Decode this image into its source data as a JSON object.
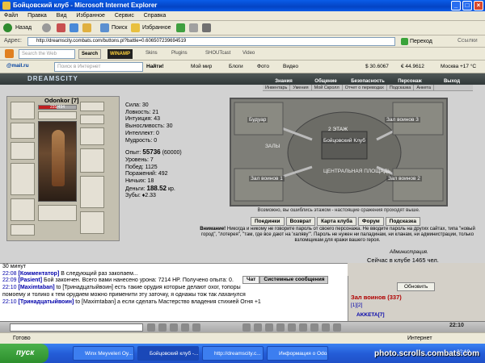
{
  "window": {
    "title": "Бойцовский клуб - Microsoft Internet Explorer"
  },
  "menu": [
    "Файл",
    "Правка",
    "Вид",
    "Избранное",
    "Сервис",
    "Справка"
  ],
  "toolbar": {
    "back": "Назад",
    "search": "Поиск",
    "favorites": "Избранное"
  },
  "address": {
    "label": "Адрес:",
    "url": "http://dreamscity.combats.com/buttons.pl?battle=0.606507239694519",
    "go": "Переход",
    "links": "Ссылки"
  },
  "winamp": {
    "search_placeholder": "Search the Web",
    "search_btn": "Search",
    "logo": "WINAMP",
    "items": [
      "Skins",
      "Plugins",
      "SHOUTcast",
      "Video"
    ]
  },
  "mailbar": {
    "logo": "@mail.ru",
    "search_placeholder": "Поиск в Интернет",
    "find": "Найти!",
    "items": [
      "Мой мир",
      "Блоги",
      "Фото",
      "Видео"
    ],
    "rate_usd": "$ 30.6067",
    "rate_eur": "€ 44.9612",
    "weather": "Москва +17 °C"
  },
  "game": {
    "banner": "DREAMSCITY",
    "nav": [
      "Знания",
      "Общение",
      "Безопасность",
      "Персонаж",
      "Выход"
    ],
    "subnav": [
      "Инвентарь",
      "Умения",
      "Мой Скролл",
      "Отчет о переводах",
      "Подсказка",
      "Анкета"
    ],
    "char_name": "Odonkor [7]",
    "hp": "231/494",
    "hp_fraction": 0.47,
    "stats": {
      "s1": "Сила: 30",
      "s2": "Ловкость: 21",
      "s3": "Интуиция: 43",
      "s4": "Выносливость: 30",
      "s5": "Интеллект: 0",
      "s6": "Мудрость: 0",
      "exp_label": "Опыт:",
      "exp": "55736",
      "exp_next": "(60000)",
      "s7": "Уровень: 7",
      "s8": "Побед: 1125",
      "s9": "Поражений: 492",
      "s10": "Ничьих: 18",
      "money_label": "Деньги:",
      "money": "188.52",
      "money_unit": "кр.",
      "teeth": "Зубы: ♦2.33"
    },
    "rooms": {
      "r1": "Будуар",
      "r2": "Зал воинов 3",
      "r3": "2 ЭТАЖ",
      "r4": "Бойцовский Клуб",
      "r5": "ЗАЛЫ",
      "r6": "ЦЕНТРАЛЬНАЯ ПЛОЩАДЬ",
      "r7": "Зал воинов 1",
      "r8": "Зал воинов 2"
    },
    "floor_hint": "Возможно, вы ошиблись этажом - настоящие сражения проходят выше.",
    "buttons": [
      "Поединки",
      "Возврат",
      "Карта клуба",
      "Форум",
      "Подсказка"
    ],
    "warning_title": "Внимание!",
    "warning_text": "Никогда и никому не говорите пароль от своего персонажа. Не вводите пароль на других сайтах, типа \"новый город\", \"лотерея\", \"там, где все дают на 'халяву'\". Пароль не нужен ни паладинам, ни кланам, ни администрации, только взломщикам для кражи вашего героя.",
    "warning_sign": "Администрация.",
    "online": "Сейчас в клубе 1465 чел."
  },
  "chat": {
    "first": "30 минут",
    "lines": [
      {
        "t": "22:08",
        "n": "[Комментатор]",
        "m": "В следующий раз закопаем..."
      },
      {
        "t": "22:09",
        "n": "[Pasient]",
        "m": "Бой закончен. Всего вами нанесено урона: 7214 HP. Получено опыта: 0."
      },
      {
        "t": "22:10",
        "n": "[Maximtaban]",
        "m": "to [Тринадцатыйвоин] есть такие орудия которые делают охог, топоры"
      },
      {
        "t": "",
        "n": "",
        "m": "помоему и толико к тем орудием можно применити эту заточку, я однажы тож так лаханулся"
      },
      {
        "t": "22:10",
        "n": "[Тринадцатыйвоин]",
        "m": "to [Maximtaban] а если сделать Мастерство владения стихией Огня +1"
      }
    ],
    "tab_chat": "Чат",
    "tab_system": "Системные сообщения"
  },
  "roster": {
    "refresh": "Обновить",
    "title": "Зал воинов (337)",
    "pages": "[1][2]",
    "user": "AKKETA[7]"
  },
  "strip_time": "22:10",
  "status": {
    "left": "Готово",
    "zone": "Интернет"
  },
  "taskbar": {
    "start": "пуск",
    "tasks": [
      "Winx Meyveleri Oy...",
      "Бойцовский клуб -...",
      "http://dreamscity.c...",
      "Информация о Odo..."
    ],
    "clock": "22:10"
  },
  "watermark": "photo.scrolls.combats.com",
  "colors": {
    "xp_blue": "#0a5ce8",
    "warn_red": "#b00000",
    "link_blue": "#0000aa"
  }
}
